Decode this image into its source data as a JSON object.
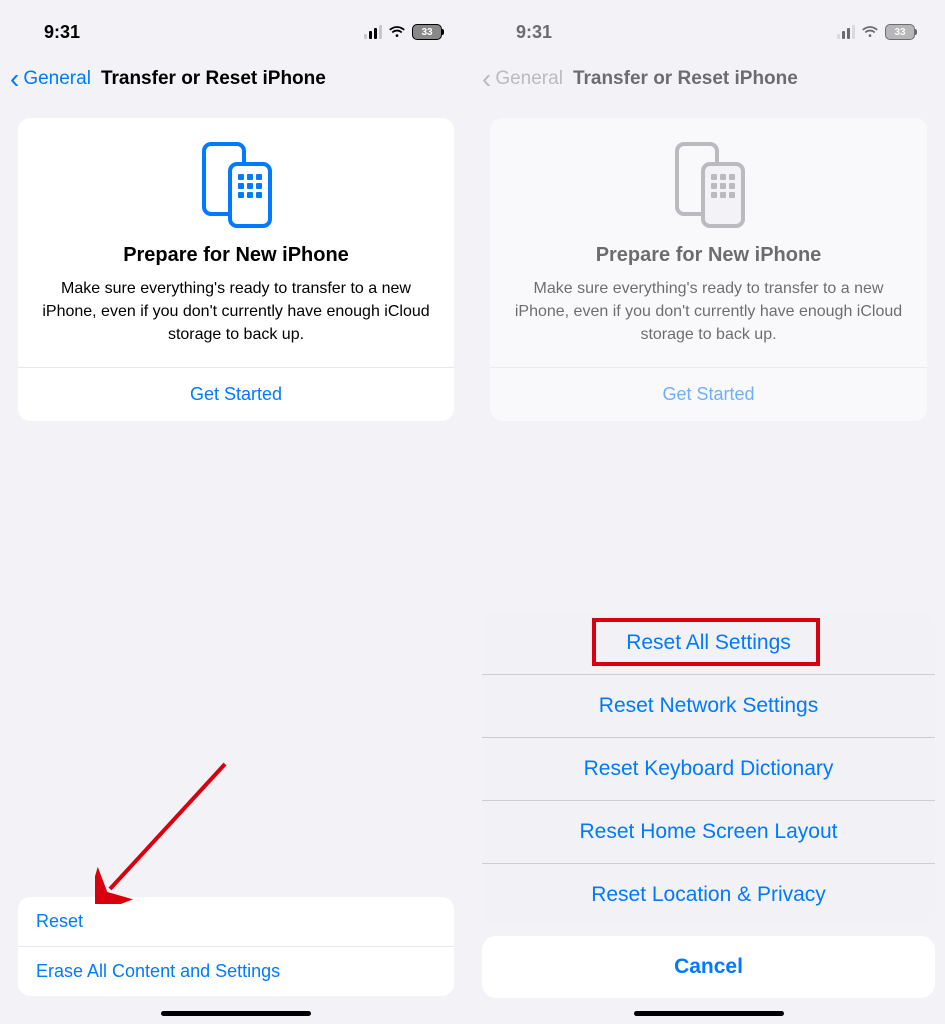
{
  "statusbar": {
    "time": "9:31",
    "battery": "33"
  },
  "nav": {
    "back": "General",
    "title": "Transfer or Reset iPhone"
  },
  "card": {
    "title": "Prepare for New iPhone",
    "desc": "Make sure everything's ready to transfer to a new iPhone, even if you don't currently have enough iCloud storage to back up.",
    "action": "Get Started"
  },
  "bottom": {
    "reset": "Reset",
    "erase": "Erase All Content and Settings"
  },
  "sheet": {
    "items": [
      "Reset All Settings",
      "Reset Network Settings",
      "Reset Keyboard Dictionary",
      "Reset Home Screen Layout",
      "Reset Location & Privacy"
    ],
    "cancel": "Cancel"
  }
}
